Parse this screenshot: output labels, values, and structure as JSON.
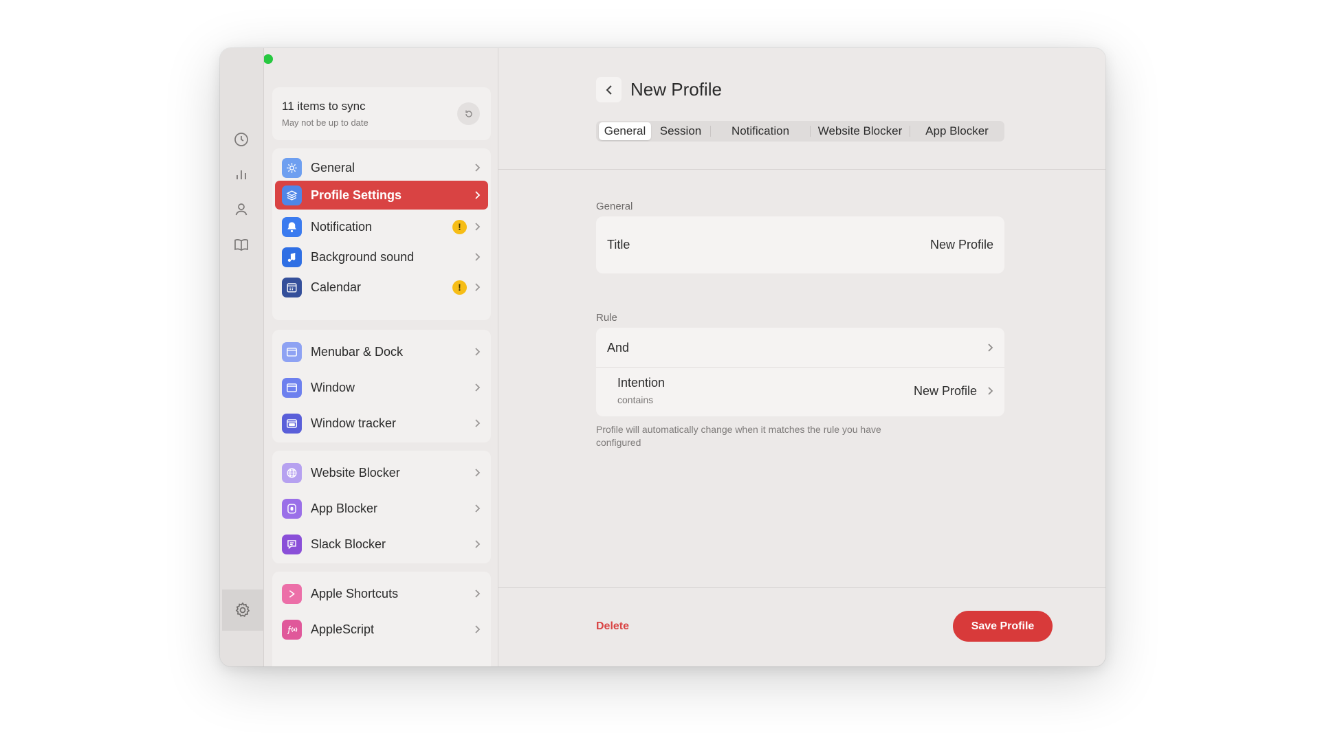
{
  "sync": {
    "title": "11 items to sync",
    "subtitle": "May not be up to date"
  },
  "sidebar": {
    "groups": [
      [
        {
          "label": "General",
          "icon": "gear-icon",
          "color": "#6e9ff0",
          "active": false,
          "warning": false
        },
        {
          "label": "Profile Settings",
          "icon": "layers-icon",
          "color": "#4f86e8",
          "active": true,
          "warning": false
        },
        {
          "label": "Notification",
          "icon": "bell-icon",
          "color": "#3b7bef",
          "active": false,
          "warning": true,
          "warning_symbol": "!"
        },
        {
          "label": "Background sound",
          "icon": "music-note-icon",
          "color": "#2f6fe4",
          "active": false,
          "warning": false
        },
        {
          "label": "Calendar",
          "icon": "calendar-icon",
          "color": "#344f9a",
          "active": false,
          "warning": true,
          "warning_symbol": "!"
        }
      ],
      [
        {
          "label": "Menubar & Dock",
          "icon": "menubar-icon",
          "color": "#8ea2f3",
          "active": false
        },
        {
          "label": "Window",
          "icon": "window-icon",
          "color": "#6d80ee",
          "active": false
        },
        {
          "label": "Window tracker",
          "icon": "window-tracker-icon",
          "color": "#5a5fd9",
          "active": false
        }
      ],
      [
        {
          "label": "Website Blocker",
          "icon": "globe-icon",
          "color": "#b6a1f0",
          "active": false
        },
        {
          "label": "App Blocker",
          "icon": "app-blocker-icon",
          "color": "#9a6fe8",
          "active": false
        },
        {
          "label": "Slack Blocker",
          "icon": "chat-icon",
          "color": "#8a4fd8",
          "active": false
        }
      ],
      [
        {
          "label": "Apple Shortcuts",
          "icon": "shortcuts-icon",
          "color": "#ec6fa8",
          "active": false
        },
        {
          "label": "AppleScript",
          "icon": "function-icon",
          "color": "#e0589a",
          "active": false
        }
      ]
    ]
  },
  "main": {
    "title": "New Profile",
    "tabs": [
      "General",
      "Session",
      "Notification",
      "Website Blocker",
      "App Blocker"
    ],
    "selected_tab": "General",
    "general_section": "General",
    "title_row": {
      "label": "Title",
      "value": "New Profile"
    },
    "rule_section": "Rule",
    "rule_operator": "And",
    "intention_row": {
      "label": "Intention",
      "sublabel": "contains",
      "value": "New Profile"
    },
    "hint": "Profile will automatically change when it matches the rule you have configured",
    "delete_label": "Delete",
    "save_label": "Save Profile"
  },
  "colors": {
    "accent": "#d94343",
    "warning": "#f6bd16",
    "background": "#ece9e8"
  }
}
